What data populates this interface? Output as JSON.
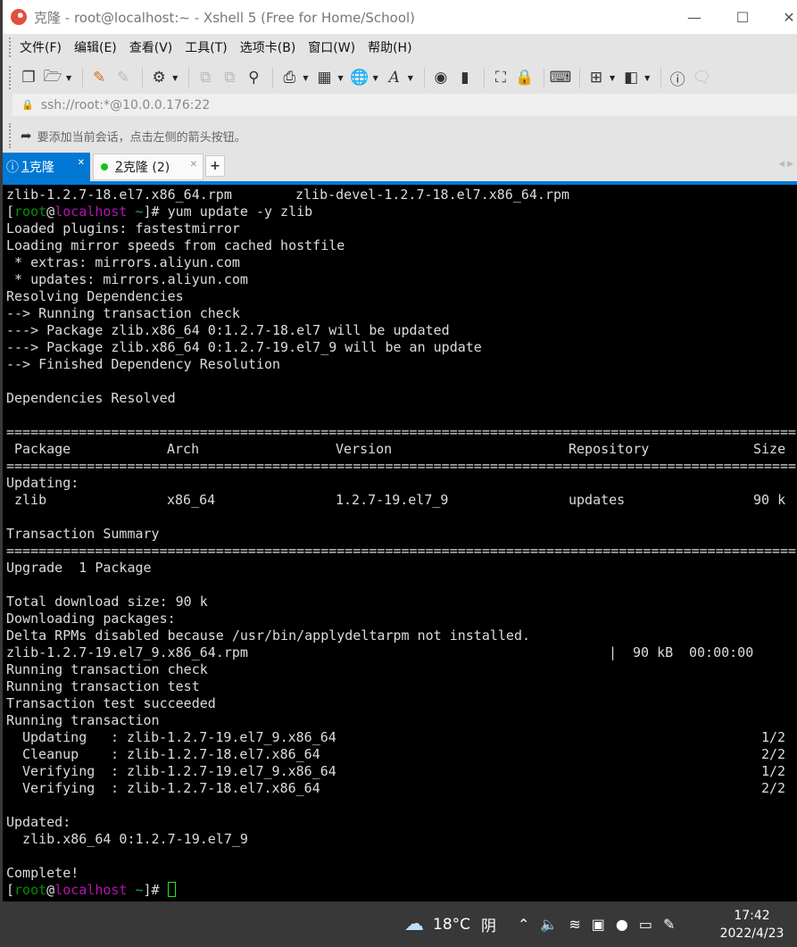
{
  "window": {
    "title": "克隆 - root@localhost:~ - Xshell 5 (Free for Home/School)"
  },
  "menu": [
    "文件(F)",
    "编辑(E)",
    "查看(V)",
    "工具(T)",
    "选项卡(B)",
    "窗口(W)",
    "帮助(H)"
  ],
  "address": "ssh://root:*@10.0.0.176:22",
  "hint": "要添加当前会话，点击左侧的箭头按钮。",
  "tabs": [
    {
      "num": "1",
      "label": " 克隆",
      "active": true
    },
    {
      "num": "2",
      "label": " 克隆 (2)",
      "active": false
    }
  ],
  "tab_add": "+",
  "terminal": {
    "lines": [
      {
        "type": "cols",
        "layout": "files",
        "cells": [
          "zlib-1.2.7-18.el7.x86_64.rpm",
          "zlib-devel-1.2.7-18.el7.x86_64.rpm"
        ]
      },
      {
        "type": "prompt",
        "user": "root",
        "host": "localhost",
        "dir": "~",
        "cmd": "yum update -y zlib"
      },
      {
        "type": "text",
        "text": "Loaded plugins: fastestmirror"
      },
      {
        "type": "text",
        "text": "Loading mirror speeds from cached hostfile"
      },
      {
        "type": "text",
        "text": " * extras: mirrors.aliyun.com"
      },
      {
        "type": "text",
        "text": " * updates: mirrors.aliyun.com"
      },
      {
        "type": "text",
        "text": "Resolving Dependencies"
      },
      {
        "type": "text",
        "text": "--> Running transaction check"
      },
      {
        "type": "text",
        "text": "---> Package zlib.x86_64 0:1.2.7-18.el7 will be updated"
      },
      {
        "type": "text",
        "text": "---> Package zlib.x86_64 0:1.2.7-19.el7_9 will be an update"
      },
      {
        "type": "text",
        "text": "--> Finished Dependency Resolution"
      },
      {
        "type": "text",
        "text": ""
      },
      {
        "type": "text",
        "text": "Dependencies Resolved"
      },
      {
        "type": "text",
        "text": ""
      },
      {
        "type": "rule",
        "char": "="
      },
      {
        "type": "cols",
        "layout": "table",
        "cells": [
          "Package",
          "Arch",
          "Version",
          "Repository",
          "Size"
        ]
      },
      {
        "type": "rule",
        "char": "="
      },
      {
        "type": "text",
        "text": "Updating:"
      },
      {
        "type": "cols",
        "layout": "table",
        "cells": [
          "zlib",
          "x86_64",
          "1.2.7-19.el7_9",
          "updates",
          "90 k"
        ]
      },
      {
        "type": "text",
        "text": ""
      },
      {
        "type": "text",
        "text": "Transaction Summary"
      },
      {
        "type": "rule",
        "char": "="
      },
      {
        "type": "text",
        "text": "Upgrade  1 Package"
      },
      {
        "type": "text",
        "text": ""
      },
      {
        "type": "text",
        "text": "Total download size: 90 k"
      },
      {
        "type": "text",
        "text": "Downloading packages:"
      },
      {
        "type": "text",
        "text": "Delta RPMs disabled because /usr/bin/applydeltarpm not installed."
      },
      {
        "type": "cols",
        "layout": "progress",
        "cells": [
          "zlib-1.2.7-19.el7_9.x86_64.rpm",
          "|",
          "90 kB",
          "00:00:00"
        ]
      },
      {
        "type": "text",
        "text": "Running transaction check"
      },
      {
        "type": "text",
        "text": "Running transaction test"
      },
      {
        "type": "text",
        "text": "Transaction test succeeded"
      },
      {
        "type": "text",
        "text": "Running transaction"
      },
      {
        "type": "cols",
        "layout": "step",
        "cells": [
          "Updating",
          ":",
          "zlib-1.2.7-19.el7_9.x86_64",
          "1/2"
        ]
      },
      {
        "type": "cols",
        "layout": "step",
        "cells": [
          "Cleanup",
          ":",
          "zlib-1.2.7-18.el7.x86_64",
          "2/2"
        ]
      },
      {
        "type": "cols",
        "layout": "step",
        "cells": [
          "Verifying",
          ":",
          "zlib-1.2.7-19.el7_9.x86_64",
          "1/2"
        ]
      },
      {
        "type": "cols",
        "layout": "step",
        "cells": [
          "Verifying",
          ":",
          "zlib-1.2.7-18.el7.x86_64",
          "2/2"
        ]
      },
      {
        "type": "text",
        "text": ""
      },
      {
        "type": "text",
        "text": "Updated:"
      },
      {
        "type": "text",
        "text": "  zlib.x86_64 0:1.2.7-19.el7_9"
      },
      {
        "type": "text",
        "text": ""
      },
      {
        "type": "text",
        "text": "Complete!"
      },
      {
        "type": "prompt",
        "user": "root",
        "host": "localhost",
        "dir": "~",
        "cmd": "",
        "cursor": true
      }
    ]
  },
  "taskbar": {
    "weather_temp": "18°C",
    "weather_desc": "阴",
    "time": "17:42",
    "date": "2022/4/23"
  }
}
